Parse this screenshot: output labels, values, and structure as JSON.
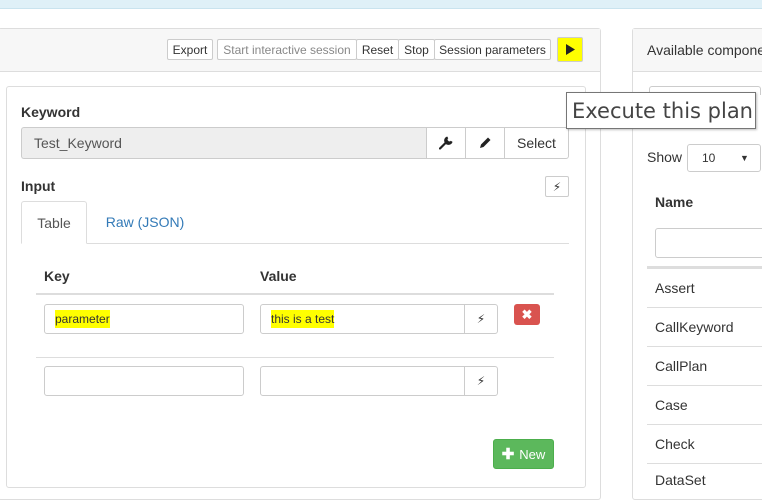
{
  "toolbar": {
    "export_label": "Export",
    "start_session_label": "Start interactive session",
    "reset_label": "Reset",
    "stop_label": "Stop",
    "session_params_label": "Session parameters",
    "execute_icon": "play-icon"
  },
  "tooltip": {
    "text": "Execute this plan"
  },
  "keyword": {
    "label": "Keyword",
    "value": "Test_Keyword",
    "wrench_icon": "wrench-icon",
    "pencil_icon": "pencil-icon",
    "select_label": "Select"
  },
  "input": {
    "label": "Input",
    "tabs": [
      {
        "label": "Table"
      },
      {
        "label": "Raw (JSON)"
      }
    ],
    "columns": {
      "key": "Key",
      "value": "Value"
    },
    "rows": [
      {
        "key": "parameter",
        "value": "this is a test"
      },
      {
        "key": "",
        "value": ""
      }
    ],
    "new_label": "New"
  },
  "components": {
    "title": "Available compone",
    "show_label": "Show",
    "page_size": "10",
    "name_column": "Name",
    "items": [
      "Assert",
      "CallKeyword",
      "CallPlan",
      "Case",
      "Check",
      "DataSet"
    ]
  },
  "colors": {
    "highlight": "#ffff00",
    "danger": "#d9534f",
    "success": "#5cb85c",
    "link": "#337ab7"
  }
}
